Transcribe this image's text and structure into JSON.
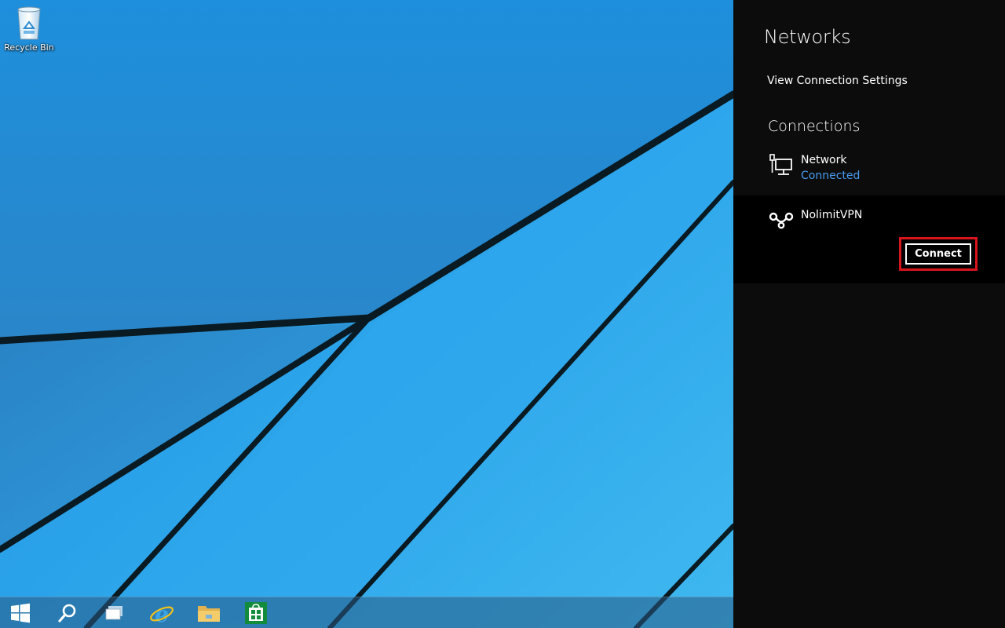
{
  "desktop": {
    "wallpaper_color": "#1e90d8",
    "icons": [
      {
        "label": "Recycle Bin",
        "icon": "recycle-bin-icon"
      }
    ]
  },
  "taskbar": {
    "items": [
      {
        "name": "start-button",
        "icon": "windows-logo-icon"
      },
      {
        "name": "search-button",
        "icon": "search-icon"
      },
      {
        "name": "task-view-button",
        "icon": "task-view-icon"
      },
      {
        "name": "internet-explorer-button",
        "icon": "internet-explorer-icon"
      },
      {
        "name": "file-explorer-button",
        "icon": "folder-icon"
      },
      {
        "name": "store-button",
        "icon": "store-icon"
      }
    ]
  },
  "network_panel": {
    "title": "Networks",
    "view_settings_link": "View Connection Settings",
    "connections_heading": "Connections",
    "connections": [
      {
        "name": "Network",
        "status": "Connected",
        "icon": "wired-network-icon"
      },
      {
        "name": "NolimitVPN",
        "status": "",
        "icon": "vpn-icon",
        "action_label": "Connect"
      }
    ],
    "colors": {
      "background": "#0c0c0c",
      "status_color": "#4a9bf0",
      "highlight_border": "#d8141c"
    }
  }
}
